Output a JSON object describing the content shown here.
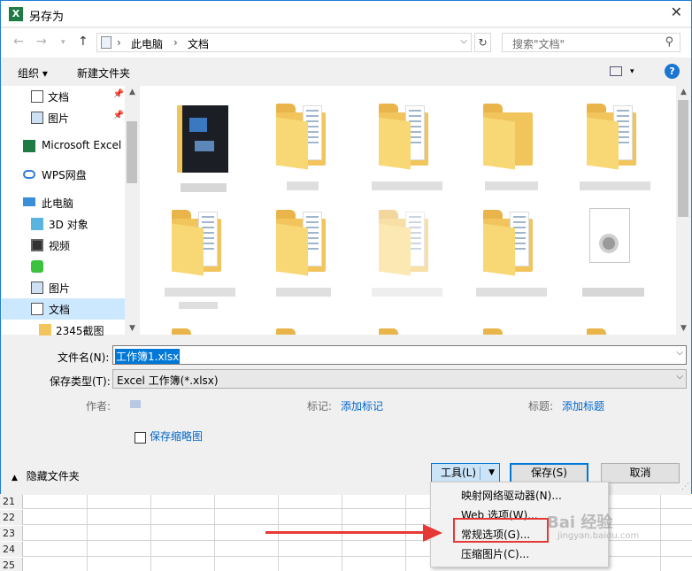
{
  "window": {
    "title": "另存为",
    "app_icon": "X"
  },
  "breadcrumb": {
    "root": "此电脑",
    "current": "文档"
  },
  "search": {
    "placeholder": "搜索\"文档\""
  },
  "toolbar": {
    "organize": "组织 ▾",
    "new_folder": "新建文件夹",
    "help": "?"
  },
  "sidebar": {
    "items": [
      {
        "label": "文档",
        "icon": "document-icon",
        "pinned": true
      },
      {
        "label": "图片",
        "icon": "picture-icon",
        "pinned": true
      },
      {
        "label": "Microsoft Excel",
        "icon": "excel-icon"
      },
      {
        "label": "WPS网盘",
        "icon": "cloud-icon"
      },
      {
        "label": "此电脑",
        "icon": "computer-icon"
      },
      {
        "label": "3D 对象",
        "icon": "3d-objects-icon"
      },
      {
        "label": "视频",
        "icon": "video-icon"
      },
      {
        "label": "",
        "icon": "wps-app-icon"
      },
      {
        "label": "图片",
        "icon": "picture-icon"
      },
      {
        "label": "文档",
        "icon": "document-icon",
        "selected": true
      },
      {
        "label": "2345截图",
        "icon": "folder-icon"
      }
    ]
  },
  "form": {
    "filename_label": "文件名(N):",
    "filename_value": "工作簿1.xlsx",
    "filetype_label": "保存类型(T):",
    "filetype_value": "Excel 工作簿(*.xlsx)",
    "author_label": "作者:",
    "tags_label": "标记:",
    "tags_link": "添加标记",
    "title_label": "标题:",
    "title_link": "添加标题",
    "thumbnail_label": "保存缩略图"
  },
  "buttons": {
    "hide_folders": "隐藏文件夹",
    "tools": "工具(L)",
    "save": "保存(S)",
    "cancel": "取消"
  },
  "tools_menu": {
    "items": [
      "映射网络驱动器(N)...",
      "Web 选项(W)...",
      "常规选项(G)...",
      "压缩图片(C)..."
    ]
  },
  "sheet": {
    "rows": [
      "21",
      "22",
      "23",
      "24",
      "25"
    ]
  },
  "watermark": {
    "text": "Bai 经验",
    "sub": "jingyan.baidu.com"
  },
  "colors": {
    "accent": "#0078d7",
    "highlight": "#e53935",
    "folder": "#f2c55c"
  }
}
